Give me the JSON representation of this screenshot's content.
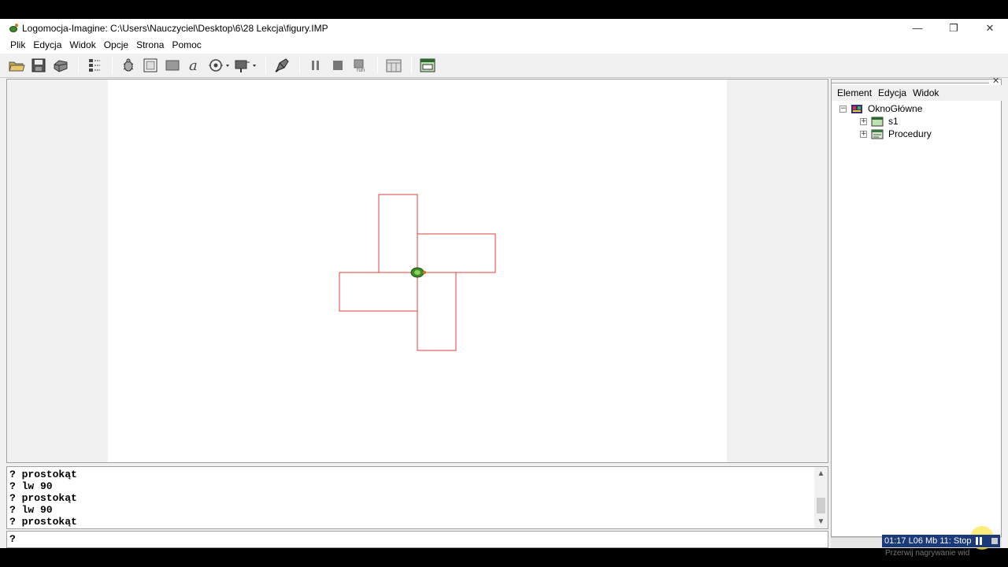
{
  "window": {
    "title": "Logomocja-Imagine: C:\\Users\\Nauczyciel\\Desktop\\6\\28 Lekcja\\figury.IMP",
    "controls": [
      "—",
      "❐",
      "✕"
    ]
  },
  "menubar": {
    "items": [
      "Plik",
      "Edycja",
      "Widok",
      "Opcje",
      "Strona",
      "Pomoc"
    ]
  },
  "toolbar": {
    "buttons": [
      "open-icon",
      "save-icon",
      "print-icon",
      "tree-icon",
      "turtle-icon",
      "frame-icon",
      "rectangle-icon",
      "text-icon",
      "media-icon",
      "control-icon",
      "pen-icon",
      "pause-icon",
      "stop-icon",
      "run-icon",
      "pages-icon",
      "page-view-icon"
    ]
  },
  "canvas": {
    "shapes": "four red rectangles arranged in a pinwheel around the turtle",
    "stroke_color": "#e03c3c"
  },
  "console": {
    "lines": [
      "? prostokąt",
      "? lw 90",
      "? prostokąt",
      "? lw 90",
      "? prostokąt"
    ]
  },
  "command_line": {
    "prompt": "?"
  },
  "right_panel": {
    "menu": [
      "Element",
      "Edycja",
      "Widok"
    ],
    "tree": {
      "root": "OknoGłówne",
      "children": [
        "s1",
        "Procedury"
      ]
    }
  },
  "recorder": {
    "status": "01:17 L06 Mb 11: Stop",
    "hint": "Przerwij nagrywanie wid"
  }
}
